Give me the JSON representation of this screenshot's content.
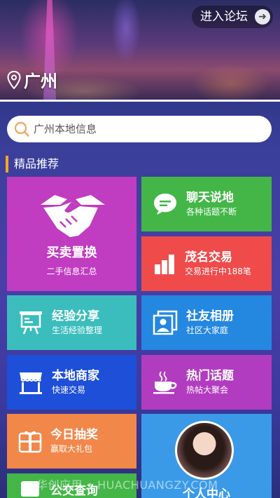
{
  "header": {
    "forum_label": "进入论坛",
    "city": "广州"
  },
  "search": {
    "placeholder": "广州本地信息"
  },
  "section": {
    "title": "精品推荐"
  },
  "tiles": {
    "trade": {
      "title": "买卖置换",
      "subtitle": "二手信息汇总",
      "color": "#c03cc0",
      "icon": "handshake-icon"
    },
    "chat": {
      "title": "聊天说地",
      "subtitle": "各种话题不断",
      "color": "#43b647",
      "icon": "chat-bubble-icon"
    },
    "maoming": {
      "title": "茂名交易",
      "subtitle": "交易进行中188笔",
      "color": "#ef4b4b",
      "icon": "bar-chart-icon"
    },
    "experience": {
      "title": "经验分享",
      "subtitle": "生活经验整理",
      "color": "#3bbdbd",
      "icon": "presentation-board-icon"
    },
    "album": {
      "title": "社友相册",
      "subtitle": "社区大家庭",
      "color": "#2487e0",
      "icon": "photo-album-icon"
    },
    "merchant": {
      "title": "本地商家",
      "subtitle": "快速交易",
      "color": "#1e4fd8",
      "icon": "shop-icon"
    },
    "hot": {
      "title": "热门话题",
      "subtitle": "热帖大聚会",
      "color": "#b23cc0",
      "icon": "coffee-cup-icon"
    },
    "lottery": {
      "title": "今日抽奖",
      "subtitle": "赢取大礼包",
      "color": "#f2874a",
      "icon": "gift-icon"
    },
    "bus": {
      "title": "公交查询",
      "color": "#43b647"
    },
    "profile": {
      "title": "个人中心",
      "color": "#3a9ae8"
    }
  },
  "watermark": "华创应用 • HUACHUANGZY.COM"
}
